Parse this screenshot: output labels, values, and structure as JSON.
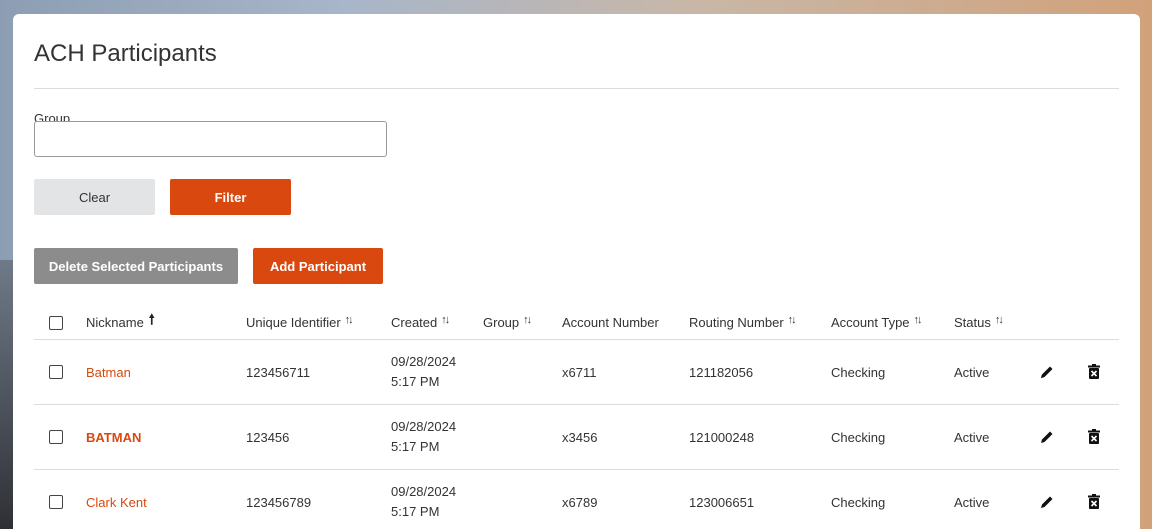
{
  "page": {
    "title": "ACH Participants"
  },
  "filter": {
    "group_label": "Group",
    "group_value": "",
    "group_placeholder": "",
    "clear_label": "Clear",
    "filter_label": "Filter"
  },
  "actions": {
    "delete_selected_label": "Delete Selected Participants",
    "add_participant_label": "Add Participant"
  },
  "table": {
    "headers": {
      "nickname": "Nickname",
      "unique_identifier": "Unique Identifier",
      "created": "Created",
      "group": "Group",
      "account_number": "Account Number",
      "routing_number": "Routing Number",
      "account_type": "Account Type",
      "status": "Status"
    },
    "rows": [
      {
        "nickname": "Batman",
        "unique_identifier": "123456711",
        "created_date": "09/28/2024",
        "created_time": "5:17 PM",
        "group": "",
        "account_number": "x6711",
        "routing_number": "121182056",
        "account_type": "Checking",
        "status": "Active"
      },
      {
        "nickname": "BATMAN",
        "unique_identifier": "123456",
        "created_date": "09/28/2024",
        "created_time": "5:17 PM",
        "group": "",
        "account_number": "x3456",
        "routing_number": "121000248",
        "account_type": "Checking",
        "status": "Active"
      },
      {
        "nickname": "Clark Kent",
        "unique_identifier": "123456789",
        "created_date": "09/28/2024",
        "created_time": "5:17 PM",
        "group": "",
        "account_number": "x6789",
        "routing_number": "123006651",
        "account_type": "Checking",
        "status": "Active"
      }
    ]
  },
  "icons": {
    "sort": "sort-icon",
    "sort_ascending": "sort-ascending-icon",
    "edit": "pencil-icon",
    "delete": "trash-icon"
  },
  "colors": {
    "accent": "#d9480f",
    "disabled_button": "#8c8c8c",
    "secondary_button": "#e2e4e6"
  }
}
